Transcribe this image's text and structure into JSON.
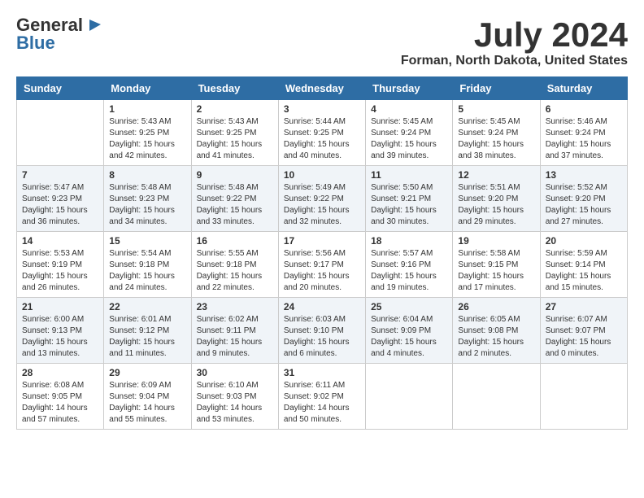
{
  "header": {
    "logo_general": "General",
    "logo_blue": "Blue",
    "month_year": "July 2024",
    "location": "Forman, North Dakota, United States"
  },
  "calendar": {
    "days_of_week": [
      "Sunday",
      "Monday",
      "Tuesday",
      "Wednesday",
      "Thursday",
      "Friday",
      "Saturday"
    ],
    "weeks": [
      [
        {
          "day": "",
          "info": ""
        },
        {
          "day": "1",
          "info": "Sunrise: 5:43 AM\nSunset: 9:25 PM\nDaylight: 15 hours\nand 42 minutes."
        },
        {
          "day": "2",
          "info": "Sunrise: 5:43 AM\nSunset: 9:25 PM\nDaylight: 15 hours\nand 41 minutes."
        },
        {
          "day": "3",
          "info": "Sunrise: 5:44 AM\nSunset: 9:25 PM\nDaylight: 15 hours\nand 40 minutes."
        },
        {
          "day": "4",
          "info": "Sunrise: 5:45 AM\nSunset: 9:24 PM\nDaylight: 15 hours\nand 39 minutes."
        },
        {
          "day": "5",
          "info": "Sunrise: 5:45 AM\nSunset: 9:24 PM\nDaylight: 15 hours\nand 38 minutes."
        },
        {
          "day": "6",
          "info": "Sunrise: 5:46 AM\nSunset: 9:24 PM\nDaylight: 15 hours\nand 37 minutes."
        }
      ],
      [
        {
          "day": "7",
          "info": "Sunrise: 5:47 AM\nSunset: 9:23 PM\nDaylight: 15 hours\nand 36 minutes."
        },
        {
          "day": "8",
          "info": "Sunrise: 5:48 AM\nSunset: 9:23 PM\nDaylight: 15 hours\nand 34 minutes."
        },
        {
          "day": "9",
          "info": "Sunrise: 5:48 AM\nSunset: 9:22 PM\nDaylight: 15 hours\nand 33 minutes."
        },
        {
          "day": "10",
          "info": "Sunrise: 5:49 AM\nSunset: 9:22 PM\nDaylight: 15 hours\nand 32 minutes."
        },
        {
          "day": "11",
          "info": "Sunrise: 5:50 AM\nSunset: 9:21 PM\nDaylight: 15 hours\nand 30 minutes."
        },
        {
          "day": "12",
          "info": "Sunrise: 5:51 AM\nSunset: 9:20 PM\nDaylight: 15 hours\nand 29 minutes."
        },
        {
          "day": "13",
          "info": "Sunrise: 5:52 AM\nSunset: 9:20 PM\nDaylight: 15 hours\nand 27 minutes."
        }
      ],
      [
        {
          "day": "14",
          "info": "Sunrise: 5:53 AM\nSunset: 9:19 PM\nDaylight: 15 hours\nand 26 minutes."
        },
        {
          "day": "15",
          "info": "Sunrise: 5:54 AM\nSunset: 9:18 PM\nDaylight: 15 hours\nand 24 minutes."
        },
        {
          "day": "16",
          "info": "Sunrise: 5:55 AM\nSunset: 9:18 PM\nDaylight: 15 hours\nand 22 minutes."
        },
        {
          "day": "17",
          "info": "Sunrise: 5:56 AM\nSunset: 9:17 PM\nDaylight: 15 hours\nand 20 minutes."
        },
        {
          "day": "18",
          "info": "Sunrise: 5:57 AM\nSunset: 9:16 PM\nDaylight: 15 hours\nand 19 minutes."
        },
        {
          "day": "19",
          "info": "Sunrise: 5:58 AM\nSunset: 9:15 PM\nDaylight: 15 hours\nand 17 minutes."
        },
        {
          "day": "20",
          "info": "Sunrise: 5:59 AM\nSunset: 9:14 PM\nDaylight: 15 hours\nand 15 minutes."
        }
      ],
      [
        {
          "day": "21",
          "info": "Sunrise: 6:00 AM\nSunset: 9:13 PM\nDaylight: 15 hours\nand 13 minutes."
        },
        {
          "day": "22",
          "info": "Sunrise: 6:01 AM\nSunset: 9:12 PM\nDaylight: 15 hours\nand 11 minutes."
        },
        {
          "day": "23",
          "info": "Sunrise: 6:02 AM\nSunset: 9:11 PM\nDaylight: 15 hours\nand 9 minutes."
        },
        {
          "day": "24",
          "info": "Sunrise: 6:03 AM\nSunset: 9:10 PM\nDaylight: 15 hours\nand 6 minutes."
        },
        {
          "day": "25",
          "info": "Sunrise: 6:04 AM\nSunset: 9:09 PM\nDaylight: 15 hours\nand 4 minutes."
        },
        {
          "day": "26",
          "info": "Sunrise: 6:05 AM\nSunset: 9:08 PM\nDaylight: 15 hours\nand 2 minutes."
        },
        {
          "day": "27",
          "info": "Sunrise: 6:07 AM\nSunset: 9:07 PM\nDaylight: 15 hours\nand 0 minutes."
        }
      ],
      [
        {
          "day": "28",
          "info": "Sunrise: 6:08 AM\nSunset: 9:05 PM\nDaylight: 14 hours\nand 57 minutes."
        },
        {
          "day": "29",
          "info": "Sunrise: 6:09 AM\nSunset: 9:04 PM\nDaylight: 14 hours\nand 55 minutes."
        },
        {
          "day": "30",
          "info": "Sunrise: 6:10 AM\nSunset: 9:03 PM\nDaylight: 14 hours\nand 53 minutes."
        },
        {
          "day": "31",
          "info": "Sunrise: 6:11 AM\nSunset: 9:02 PM\nDaylight: 14 hours\nand 50 minutes."
        },
        {
          "day": "",
          "info": ""
        },
        {
          "day": "",
          "info": ""
        },
        {
          "day": "",
          "info": ""
        }
      ]
    ]
  }
}
